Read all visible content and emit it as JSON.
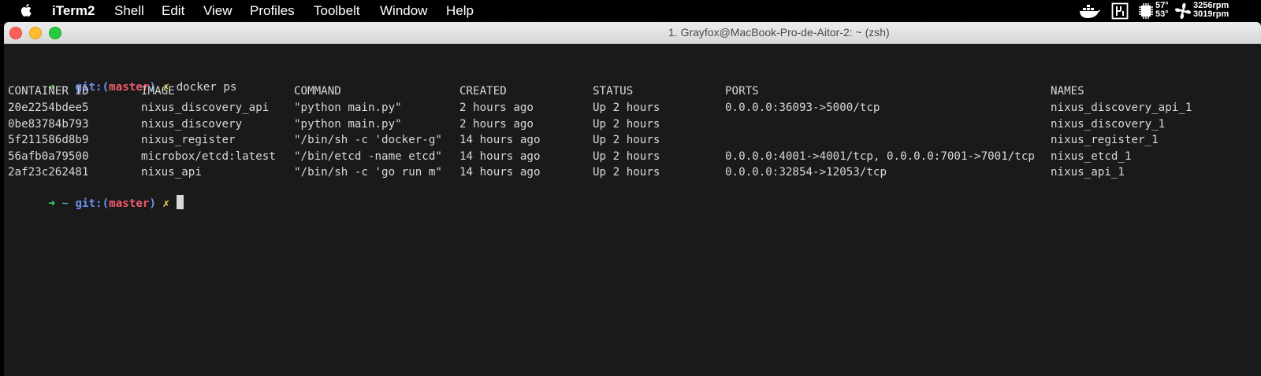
{
  "menubar": {
    "app_name": "iTerm2",
    "menus": [
      "Shell",
      "Edit",
      "View",
      "Profiles",
      "Toolbelt",
      "Window",
      "Help"
    ],
    "status": {
      "cpu_temp": "57°",
      "gpu_temp": "53°",
      "fan1": "3256rpm",
      "fan2": "3019rpm"
    }
  },
  "window": {
    "title": "1. Grayfox@MacBook-Pro-de-Aitor-2: ~ (zsh)"
  },
  "terminal": {
    "prompt": {
      "arrow": "➜",
      "dir": "~",
      "git_prefix": "git:(",
      "branch": "master",
      "git_suffix": ")",
      "dirty": "✗"
    },
    "command": "docker ps",
    "headers": [
      "CONTAINER ID",
      "IMAGE",
      "COMMAND",
      "CREATED",
      "STATUS",
      "PORTS",
      "NAMES"
    ],
    "rows": [
      [
        "20e2254bdee5",
        "nixus_discovery_api",
        "\"python main.py\"",
        "2 hours ago",
        "Up 2 hours",
        "0.0.0.0:36093->5000/tcp",
        "nixus_discovery_api_1"
      ],
      [
        "0be83784b793",
        "nixus_discovery",
        "\"python main.py\"",
        "2 hours ago",
        "Up 2 hours",
        "",
        "nixus_discovery_1"
      ],
      [
        "5f211586d8b9",
        "nixus_register",
        "\"/bin/sh -c 'docker-g\"",
        "14 hours ago",
        "Up 2 hours",
        "",
        "nixus_register_1"
      ],
      [
        "56afb0a79500",
        "microbox/etcd:latest",
        "\"/bin/etcd -name etcd\"",
        "14 hours ago",
        "Up 2 hours",
        "0.0.0.0:4001->4001/tcp, 0.0.0.0:7001->7001/tcp",
        "nixus_etcd_1"
      ],
      [
        "2af23c262481",
        "nixus_api",
        "\"/bin/sh -c 'go run m\"",
        "14 hours ago",
        "Up 2 hours",
        "0.0.0.0:32854->12053/tcp",
        "nixus_api_1"
      ]
    ]
  }
}
